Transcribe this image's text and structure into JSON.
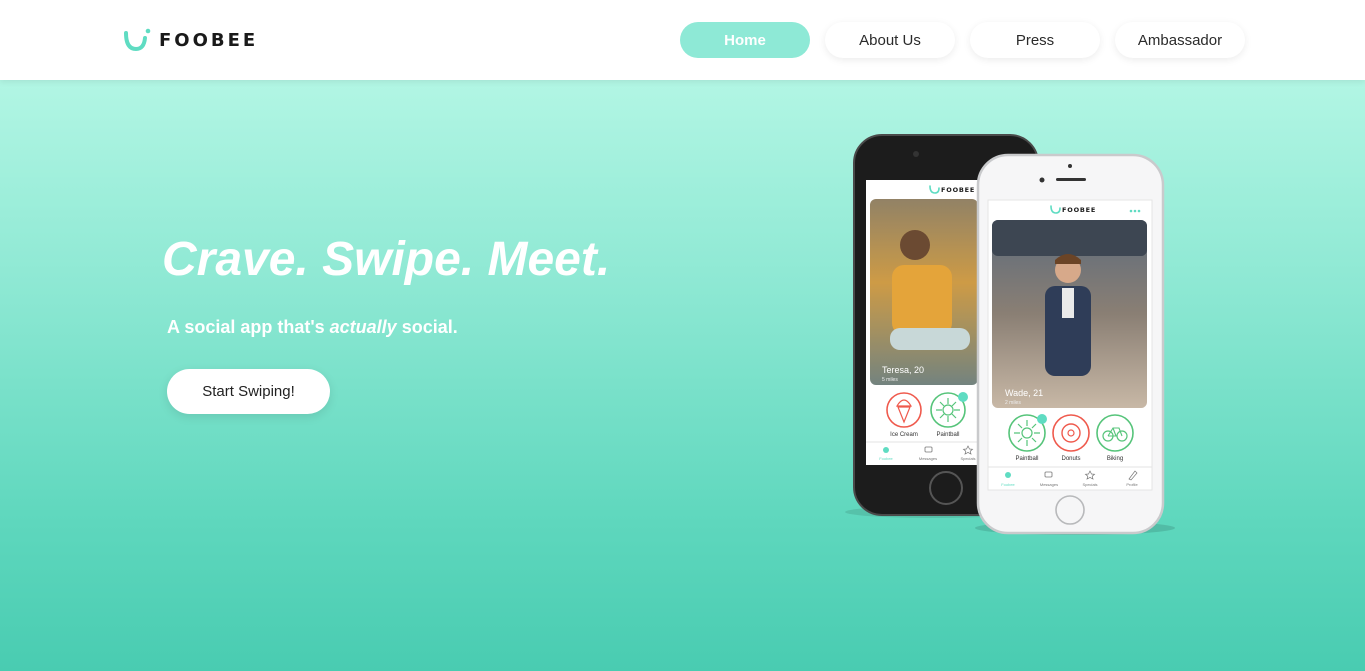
{
  "brand": {
    "name": "FOOBEE",
    "accent": "#5fdcc2",
    "nav_active": "#8ee9d6"
  },
  "nav": {
    "items": [
      {
        "label": "Home",
        "active": true
      },
      {
        "label": "About Us",
        "active": false
      },
      {
        "label": "Press",
        "active": false
      },
      {
        "label": "Ambassador",
        "active": false
      }
    ]
  },
  "hero": {
    "headline": "Crave. Swipe. Meet.",
    "sub_before": "A social app that's ",
    "sub_emphasis": "actually",
    "sub_after": " social.",
    "cta_label": "Start Swiping!"
  },
  "phone_back": {
    "app_name": "FOOBEE",
    "profile_name": "Teresa, 20",
    "profile_distance": "5 miles",
    "interests": [
      "Ice Cream",
      "Paintball"
    ],
    "tabs": [
      "Foobee",
      "Messages",
      "Specials"
    ]
  },
  "phone_front": {
    "app_name": "FOOBEE",
    "profile_name": "Wade, 21",
    "profile_distance": "2 miles",
    "interests": [
      "Paintball",
      "Donuts",
      "Biking"
    ],
    "tabs": [
      "Foobee",
      "Messages",
      "Specials",
      "Profile"
    ]
  }
}
